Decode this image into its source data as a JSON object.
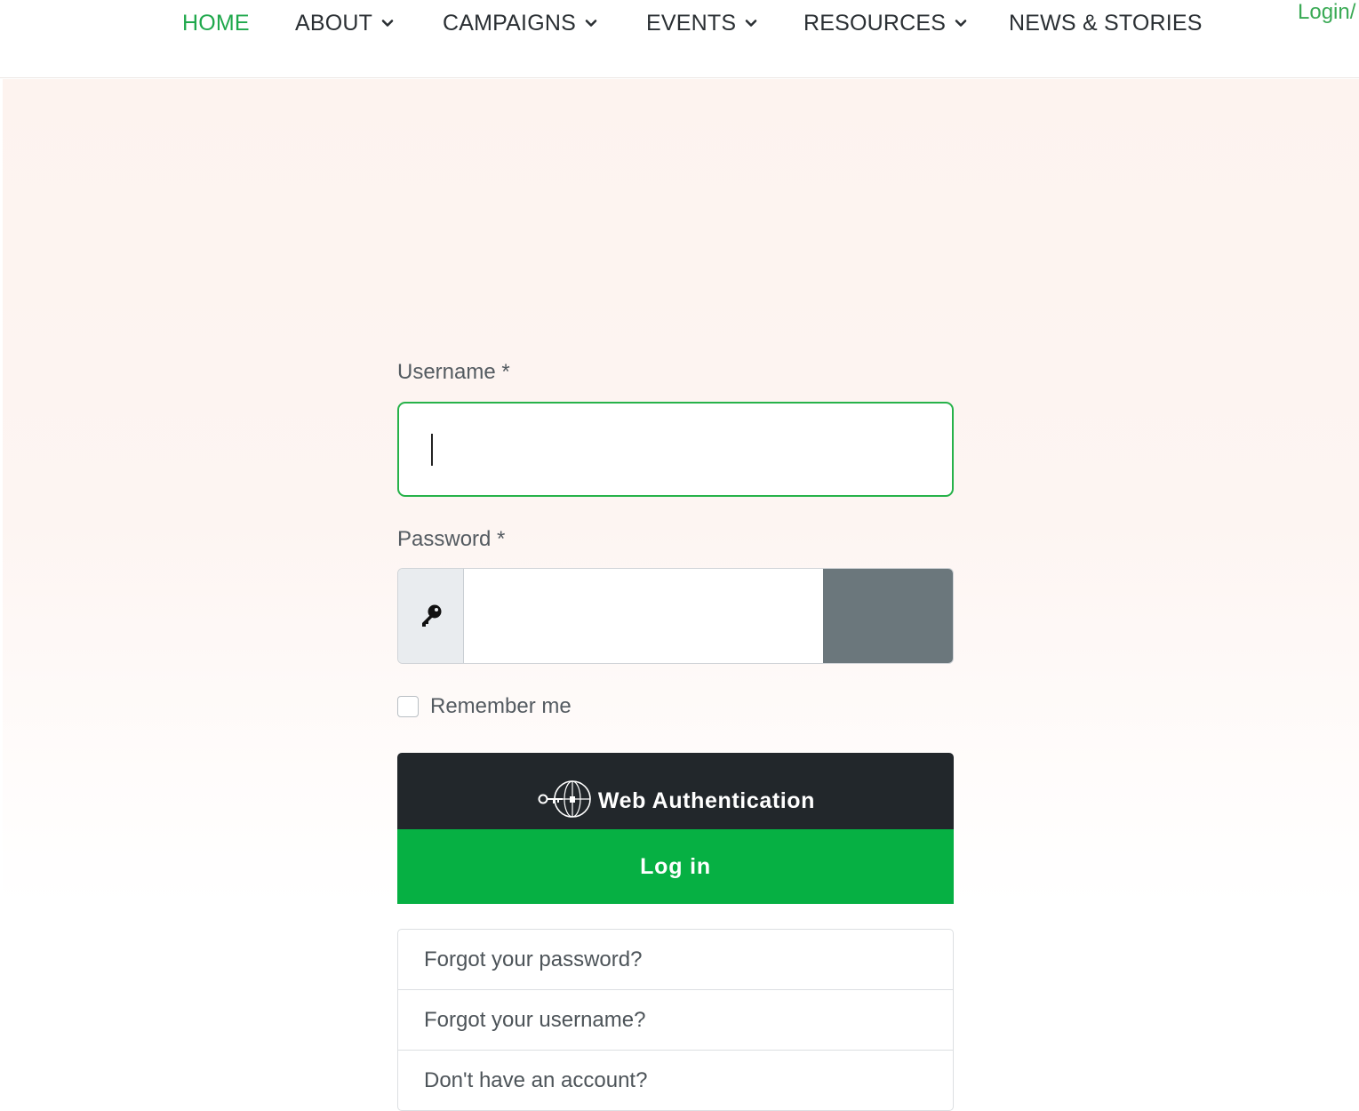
{
  "nav": {
    "items": [
      {
        "label": "HOME",
        "active": true,
        "dropdown": false
      },
      {
        "label": "ABOUT",
        "active": false,
        "dropdown": true
      },
      {
        "label": "CAMPAIGNS",
        "active": false,
        "dropdown": true
      },
      {
        "label": "EVENTS",
        "active": false,
        "dropdown": true
      },
      {
        "label": "RESOURCES",
        "active": false,
        "dropdown": true
      },
      {
        "label": "NEWS & STORIES",
        "active": false,
        "dropdown": false
      }
    ],
    "login_label": "Login/"
  },
  "form": {
    "username_label": "Username *",
    "username_value": "",
    "password_label": "Password *",
    "password_value": "",
    "password_icon": "key-icon",
    "remember_label": "Remember me",
    "remember_checked": false,
    "webauthn_label": "Web Authentication",
    "webauthn_icon": "webauthn-icon",
    "login_label": "Log in"
  },
  "links": [
    "Forgot your password?",
    "Forgot your username?",
    "Don't have an account?"
  ],
  "colors": {
    "accent_green": "#06b043",
    "dark_button": "#22272b",
    "toggle_gray": "#6b777c",
    "focus_border": "#27b24a"
  }
}
